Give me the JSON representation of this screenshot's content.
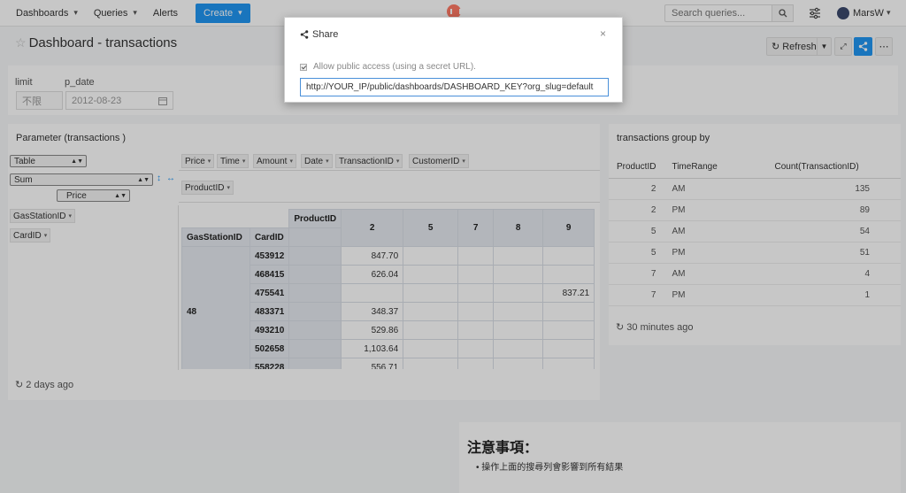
{
  "nav": {
    "dashboards": "Dashboards",
    "queries": "Queries",
    "alerts": "Alerts",
    "create": "Create",
    "search_placeholder": "Search queries...",
    "user": "MarsW",
    "caret": "▾"
  },
  "dashboard": {
    "title": "Dashboard - transactions",
    "refresh": "Refresh"
  },
  "params": {
    "limit_label": "limit",
    "limit_value": "不限",
    "date_label": "p_date",
    "date_value": "2012-08-23"
  },
  "pivot": {
    "title": "Parameter (transactions )",
    "renderer": "Table",
    "aggregator": "Sum",
    "value_field": "Price",
    "unused_fields": [
      "Price",
      "Time",
      "Amount",
      "Date",
      "TransactionID",
      "CustomerID"
    ],
    "col_fields": [
      "ProductID"
    ],
    "row_fields": [
      "GasStationID",
      "CardID"
    ],
    "col_header": "ProductID",
    "row_header_1": "GasStationID",
    "row_header_2": "CardID",
    "station": "48",
    "columns": [
      "2",
      "5",
      "7",
      "8",
      "9"
    ],
    "rows": [
      {
        "card": "453912",
        "v2": "847.70",
        "v9": ""
      },
      {
        "card": "468415",
        "v2": "626.04",
        "v9": ""
      },
      {
        "card": "475541",
        "v2": "",
        "v9": "837.21"
      },
      {
        "card": "483371",
        "v2": "348.37",
        "v9": ""
      },
      {
        "card": "493210",
        "v2": "529.86",
        "v9": ""
      },
      {
        "card": "502658",
        "v2": "1,103.64",
        "v9": ""
      },
      {
        "card": "558228",
        "v2": "556.71",
        "v9": ""
      }
    ],
    "updated": "2 days ago"
  },
  "groupby": {
    "title": "transactions group by",
    "headers": [
      "ProductID",
      "TimeRange",
      "Count(TransactionID)"
    ],
    "rows": [
      [
        "2",
        "AM",
        "135"
      ],
      [
        "2",
        "PM",
        "89"
      ],
      [
        "5",
        "AM",
        "54"
      ],
      [
        "5",
        "PM",
        "51"
      ],
      [
        "7",
        "AM",
        "4"
      ],
      [
        "7",
        "PM",
        "1"
      ]
    ],
    "updated": "30 minutes ago"
  },
  "note": {
    "title": "注意事項：",
    "item": "操作上面的搜尋列會影響到所有結果"
  },
  "share_modal": {
    "title": "Share",
    "checkbox_label": "Allow public access (using a secret URL).",
    "url": "http://YOUR_IP/public/dashboards/DASHBOARD_KEY?org_slug=default"
  },
  "colors": {
    "primary": "#2196F3",
    "logo": "#ff7964"
  }
}
